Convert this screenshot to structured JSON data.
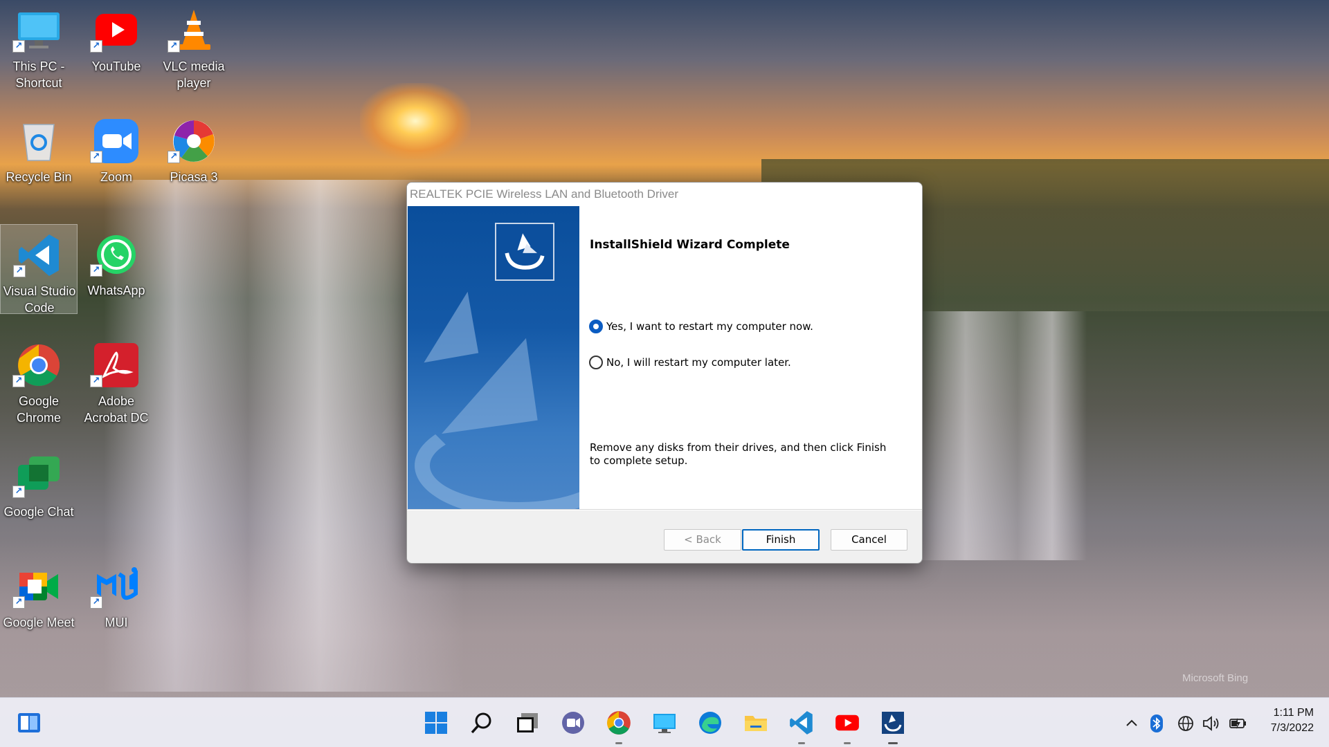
{
  "desktop": {
    "icons": [
      {
        "id": "this-pc",
        "label": "This PC -\nShortcut",
        "shortcut": true,
        "icon": "monitor-icon"
      },
      {
        "id": "youtube",
        "label": "YouTube",
        "shortcut": true,
        "icon": "youtube-icon"
      },
      {
        "id": "vlc",
        "label": "VLC media player",
        "shortcut": true,
        "icon": "vlc-cone-icon"
      },
      {
        "id": "recycle-bin",
        "label": "Recycle Bin",
        "shortcut": false,
        "icon": "recycle-bin-icon"
      },
      {
        "id": "zoom",
        "label": "Zoom",
        "shortcut": true,
        "icon": "zoom-camera-icon"
      },
      {
        "id": "picasa",
        "label": "Picasa 3",
        "shortcut": true,
        "icon": "picasa-icon"
      },
      {
        "id": "vscode",
        "label": "Visual Studio Code",
        "shortcut": true,
        "icon": "vscode-icon"
      },
      {
        "id": "whatsapp",
        "label": "WhatsApp",
        "shortcut": true,
        "icon": "whatsapp-icon"
      },
      {
        "id": "chrome",
        "label": "Google Chrome",
        "shortcut": true,
        "icon": "chrome-icon"
      },
      {
        "id": "acrobat",
        "label": "Adobe Acrobat DC",
        "shortcut": true,
        "icon": "acrobat-icon"
      },
      {
        "id": "google-chat",
        "label": "Google Chat",
        "shortcut": true,
        "icon": "google-chat-icon"
      },
      {
        "id": "google-meet",
        "label": "Google Meet",
        "shortcut": true,
        "icon": "google-meet-icon"
      },
      {
        "id": "mui",
        "label": "MUI",
        "shortcut": true,
        "icon": "mui-icon"
      }
    ],
    "watermark": "Microsoft Bing"
  },
  "dialog": {
    "title": "REALTEK PCIE Wireless LAN and Bluetooth Driver",
    "heading": "InstallShield Wizard Complete",
    "options": [
      {
        "label": "Yes, I want to restart my computer now.",
        "checked": true
      },
      {
        "label": "No, I will restart my computer later.",
        "checked": false
      }
    ],
    "note": "Remove any disks from their drives, and then click Finish to complete setup.",
    "buttons": {
      "back": "< Back",
      "finish": "Finish",
      "cancel": "Cancel"
    }
  },
  "taskbar": {
    "apps": [
      "widgets-icon",
      "start-icon",
      "search-icon",
      "task-view-icon",
      "teams-chat-icon",
      "chrome-icon",
      "remote-desktop-icon",
      "edge-icon",
      "file-explorer-icon",
      "vscode-icon",
      "youtube-icon",
      "installshield-icon"
    ],
    "clock": {
      "time": "1:11 PM",
      "date": "7/3/2022"
    }
  },
  "colors": {
    "accent": "#0067c0",
    "dialog_blue": "#0a4e9b"
  }
}
